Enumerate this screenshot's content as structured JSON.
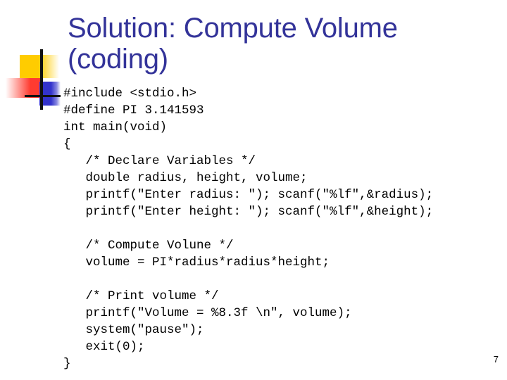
{
  "slide": {
    "title": "Solution: Compute Volume\n(coding)",
    "page_number": "7",
    "code_lines": [
      "#include <stdio.h>",
      "#define PI 3.141593",
      "int main(void)",
      "{",
      "   /* Declare Variables */",
      "   double radius, height, volume;",
      "   printf(\"Enter radius: \"); scanf(\"%lf\",&radius);",
      "   printf(\"Enter height: \"); scanf(\"%lf\",&height);",
      "",
      "   /* Compute Volune */",
      "   volume = PI*radius*radius*height;",
      "",
      "   /* Print volume */",
      "   printf(\"Volume = %8.3f \\n\", volume);",
      "   system(\"pause\");",
      "   exit(0);",
      "}"
    ],
    "code_text": "#include <stdio.h>\n#define PI 3.141593\nint main(void)\n{\n   /* Declare Variables */\n   double radius, height, volume;\n   printf(\"Enter radius: \"); scanf(\"%lf\",&radius);\n   printf(\"Enter height: \"); scanf(\"%lf\",&height);\n\n   /* Compute Volune */\n   volume = PI*radius*radius*height;\n\n   /* Print volume */\n   printf(\"Volume = %8.3f \\n\", volume);\n   system(\"pause\");\n   exit(0);\n}"
  },
  "colors": {
    "title_text": "#333399",
    "code_text": "#000000",
    "background": "#ffffff",
    "deco_yellow": "#FFCC00",
    "deco_red": "#FF3B30",
    "deco_blue": "#3333CC",
    "deco_line": "#111111"
  }
}
